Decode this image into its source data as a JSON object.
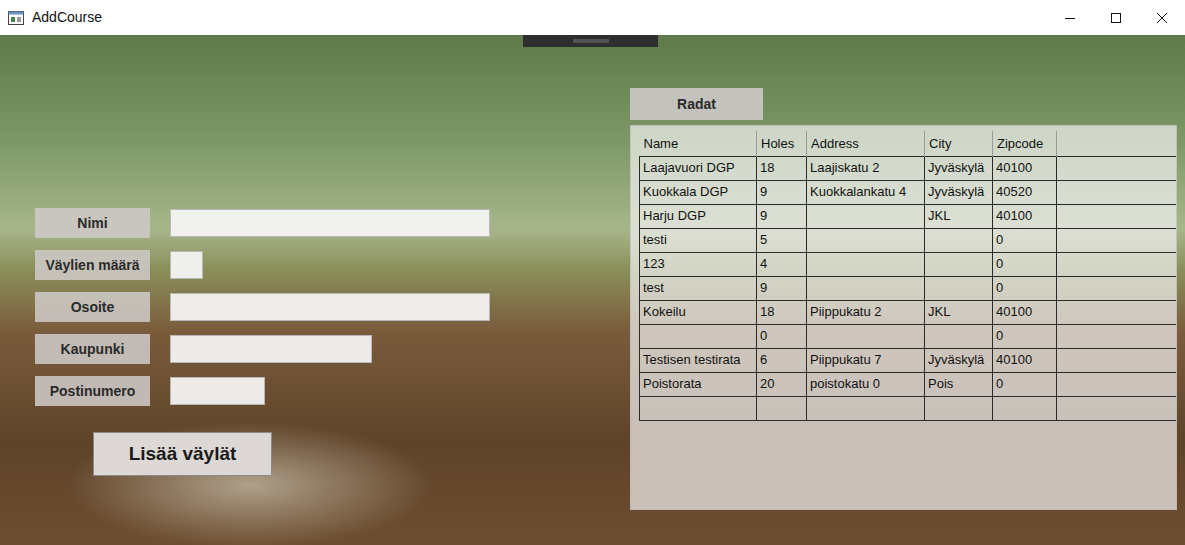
{
  "window": {
    "title": "AddCourse"
  },
  "form": {
    "fields": [
      {
        "label": "Nimi",
        "value": ""
      },
      {
        "label": "Väylien määrä",
        "value": ""
      },
      {
        "label": "Osoite",
        "value": ""
      },
      {
        "label": "Kaupunki",
        "value": ""
      },
      {
        "label": "Postinumero",
        "value": ""
      }
    ],
    "button": "Lisää väylät"
  },
  "courses": {
    "title": "Radat",
    "columns": [
      "Name",
      "Holes",
      "Address",
      "City",
      "Zipcode"
    ],
    "rows": [
      [
        "Laajavuori DGP",
        "18",
        "Laajiskatu 2",
        "Jyväskylä",
        "40100"
      ],
      [
        "Kuokkala DGP",
        "9",
        "Kuokkalankatu 4",
        "Jyväskylä",
        "40520"
      ],
      [
        "Harju DGP",
        "9",
        "",
        "JKL",
        "40100"
      ],
      [
        "testi",
        "5",
        "",
        "",
        "0"
      ],
      [
        "123",
        "4",
        "",
        "",
        "0"
      ],
      [
        "test",
        "9",
        "",
        "",
        "0"
      ],
      [
        "Kokeilu",
        "18",
        "Piippukatu 2",
        "JKL",
        "40100"
      ],
      [
        "",
        "0",
        "",
        "",
        "0"
      ],
      [
        "Testisen testirata",
        "6",
        "Piippukatu 7",
        "Jyväskylä",
        "40100"
      ],
      [
        "Poistorata",
        "20",
        "poistokatu 0",
        "Pois",
        "0"
      ]
    ]
  }
}
